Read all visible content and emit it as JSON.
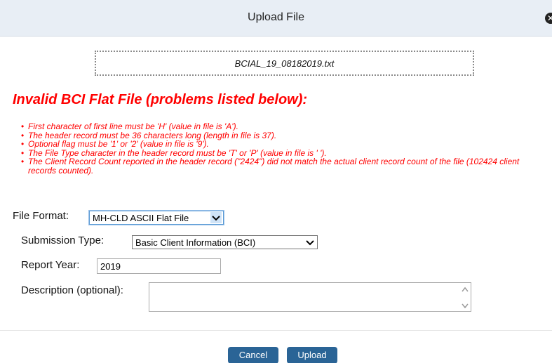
{
  "dialog": {
    "title": "Upload File",
    "close_glyph": "✕"
  },
  "upload": {
    "filename": "BCIAL_19_08182019.txt"
  },
  "errors": {
    "heading": "Invalid BCI Flat File (problems listed below):",
    "items": [
      "First character of first line must be 'H' (value in file is 'A').",
      "The header record must be 36 characters long (length in file is 37).",
      "Optional flag must be '1' or '2' (value in file is '9').",
      "The File Type character in the header record must be 'T' or 'P' (value in file is ' ').",
      "The Client Record Count reported in the header record (\"2424\") did not match the actual client record count of the file (102424 client records counted)."
    ]
  },
  "form": {
    "file_format_label": "File Format:",
    "file_format_value": "MH-CLD ASCII Flat File",
    "submission_type_label": "Submission Type:",
    "submission_type_value": "Basic Client Information (BCI)",
    "report_year_label": "Report Year:",
    "report_year_value": "2019",
    "description_label": "Description (optional):",
    "description_value": ""
  },
  "buttons": {
    "cancel": "Cancel",
    "upload": "Upload"
  },
  "colors": {
    "error": "#ff0000",
    "button": "#2a6496",
    "titlebar": "#e8eef5"
  },
  "icons": {
    "close": "close-icon",
    "dropdown": "chevron-down-icon",
    "scroll": "scroll-arrows-icon"
  }
}
